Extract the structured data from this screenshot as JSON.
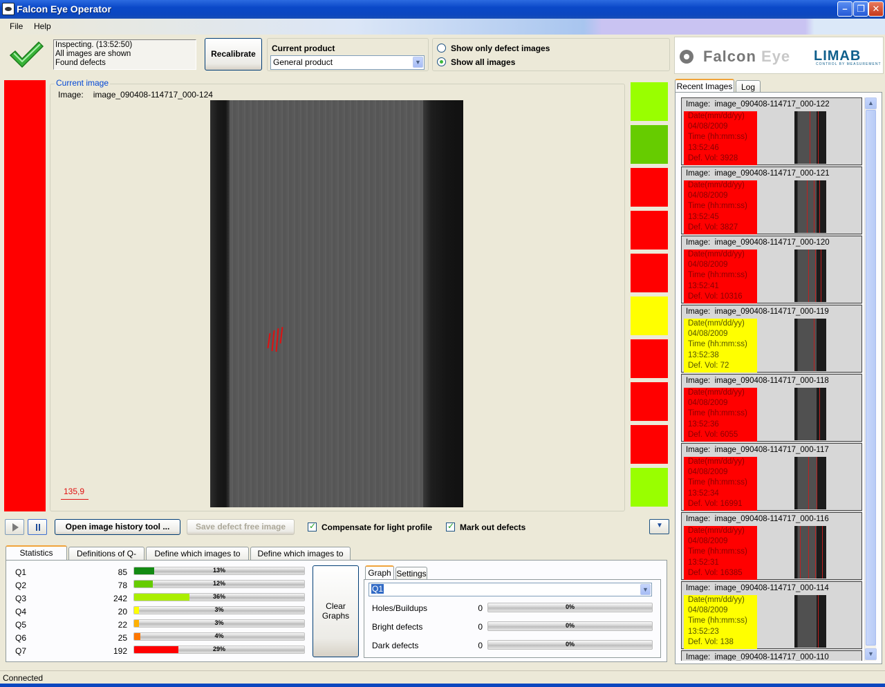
{
  "window": {
    "title": "Falcon Eye Operator"
  },
  "menu": {
    "file": "File",
    "help": "Help"
  },
  "status": {
    "line1": "Inspecting. (13:52:50)",
    "line2": "All images are shown",
    "line3": "Found defects"
  },
  "toolbar": {
    "recalibrate": "Recalibrate"
  },
  "product": {
    "label": "Current product",
    "selected": "General product"
  },
  "show": {
    "only_defects": "Show only defect images",
    "all_images": "Show all images"
  },
  "logo": {
    "name_part1": "Falcon ",
    "name_part2": "Eye",
    "brand": "LIMAB",
    "brand_sub": "CONTROL BY MEASUREMENT"
  },
  "current_image": {
    "legend": "Current image",
    "label": "Image:",
    "name": "image_090408-114717_000-124",
    "scale": "135,9"
  },
  "history_colors": [
    "#99ff00",
    "#66cc00",
    "#ff0000",
    "#ff0000",
    "#ff0000",
    "#ffff00",
    "#ff0000",
    "#ff0000",
    "#ff0000",
    "#99ff00"
  ],
  "controls": {
    "open_history": "Open image history tool ...",
    "save_defect_free": "Save defect free image",
    "compensate": "Compensate for light profile",
    "mark_defects": "Mark out defects"
  },
  "tabs": {
    "stats": "Statistics graphs",
    "qdefs": "Definitions of Q-levels",
    "show_def": "Define which images to show",
    "save_def": "Define which images to save"
  },
  "qlevels": [
    {
      "label": "Q1",
      "count": "85",
      "pct": "13%",
      "fraction": 0.13,
      "color": "#138a13"
    },
    {
      "label": "Q2",
      "count": "78",
      "pct": "12%",
      "fraction": 0.12,
      "color": "#66cc00"
    },
    {
      "label": "Q3",
      "count": "242",
      "pct": "36%",
      "fraction": 0.36,
      "color": "#aaee00"
    },
    {
      "label": "Q4",
      "count": "20",
      "pct": "3%",
      "fraction": 0.03,
      "color": "#ffff00"
    },
    {
      "label": "Q5",
      "count": "22",
      "pct": "3%",
      "fraction": 0.03,
      "color": "#ffb000"
    },
    {
      "label": "Q6",
      "count": "25",
      "pct": "4%",
      "fraction": 0.04,
      "color": "#ff7700"
    },
    {
      "label": "Q7",
      "count": "192",
      "pct": "29%",
      "fraction": 0.29,
      "color": "#ff0000"
    }
  ],
  "clear_graphs": {
    "line1": "Clear",
    "line2": "Graphs"
  },
  "graph_tabs": {
    "graph": "Graph",
    "settings": "Settings"
  },
  "graph_select": {
    "value": "Q1"
  },
  "metrics": [
    {
      "label": "Holes/Buildups",
      "count": "0",
      "pct": "0%"
    },
    {
      "label": "Bright defects",
      "count": "0",
      "pct": "0%"
    },
    {
      "label": "Dark defects",
      "count": "0",
      "pct": "0%"
    }
  ],
  "recent_tabs": {
    "recent": "Recent Images",
    "log": "Log"
  },
  "recent": [
    {
      "name": "image_090408-114717_000-122",
      "date_label": "Date(mm/dd/yy)",
      "date": "04/08/2009",
      "time_label": "Time (hh:mm:ss)",
      "time": "13:52:46",
      "vol": "Def. Vol: 3928",
      "color": "red"
    },
    {
      "name": "image_090408-114717_000-121",
      "date_label": "Date(mm/dd/yy)",
      "date": "04/08/2009",
      "time_label": "Time (hh:mm:ss)",
      "time": "13:52:45",
      "vol": "Def. Vol: 3827",
      "color": "red"
    },
    {
      "name": "image_090408-114717_000-120",
      "date_label": "Date(mm/dd/yy)",
      "date": "04/08/2009",
      "time_label": "Time (hh:mm:ss)",
      "time": "13:52:41",
      "vol": "Def. Vol: 10316",
      "color": "red"
    },
    {
      "name": "image_090408-114717_000-119",
      "date_label": "Date(mm/dd/yy)",
      "date": "04/08/2009",
      "time_label": "Time (hh:mm:ss)",
      "time": "13:52:38",
      "vol": "Def. Vol: 72",
      "color": "yellow"
    },
    {
      "name": "image_090408-114717_000-118",
      "date_label": "Date(mm/dd/yy)",
      "date": "04/08/2009",
      "time_label": "Time (hh:mm:ss)",
      "time": "13:52:36",
      "vol": "Def. Vol: 6055",
      "color": "red"
    },
    {
      "name": "image_090408-114717_000-117",
      "date_label": "Date(mm/dd/yy)",
      "date": "04/08/2009",
      "time_label": "Time (hh:mm:ss)",
      "time": "13:52:34",
      "vol": "Def. Vol: 16991",
      "color": "red"
    },
    {
      "name": "image_090408-114717_000-116",
      "date_label": "Date(mm/dd/yy)",
      "date": "04/08/2009",
      "time_label": "Time (hh:mm:ss)",
      "time": "13:52:31",
      "vol": "Def. Vol: 16385",
      "color": "red"
    },
    {
      "name": "image_090408-114717_000-114",
      "date_label": "Date(mm/dd/yy)",
      "date": "04/08/2009",
      "time_label": "Time (hh:mm:ss)",
      "time": "13:52:23",
      "vol": "Def. Vol: 138",
      "color": "yellow"
    },
    {
      "name": "image_090408-114717_000-110",
      "date_label": "",
      "date": "",
      "time_label": "",
      "time": "",
      "vol": "",
      "color": "red"
    }
  ],
  "statusbar": {
    "text": "Connected"
  },
  "icons": {
    "ok": "checkmark-icon",
    "play": "play-icon",
    "pause": "pause-icon",
    "dropdown": "chevron-down-icon"
  }
}
